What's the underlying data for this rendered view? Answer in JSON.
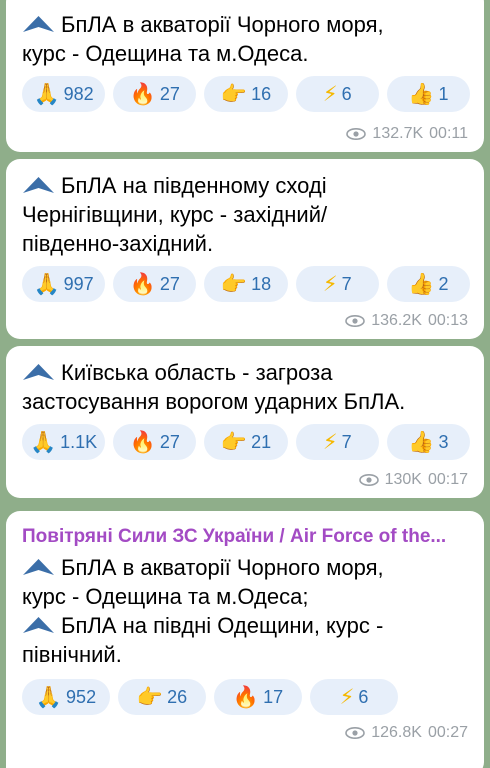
{
  "colors": {
    "background": "#8fae8a",
    "bubble": "#ffffff",
    "reaction_bg": "#e7effa",
    "reaction_text": "#2f6fb0",
    "sender": "#a34bc4",
    "meta": "#9aa0a6"
  },
  "messages": [
    {
      "lines": [
        "БпЛА в акваторії Чорного моря,",
        "курс - Одещина та м.Одеса."
      ],
      "drone_lines": [
        0
      ],
      "reactions": [
        {
          "icon": "praying-hands-icon",
          "count": "982"
        },
        {
          "icon": "fire-icon",
          "count": "27"
        },
        {
          "icon": "pointing-hand-icon",
          "count": "16"
        },
        {
          "icon": "lightning-icon",
          "count": "6"
        },
        {
          "icon": "thumbs-up-icon",
          "count": "1"
        }
      ],
      "views": "132.7K",
      "time": "00:11"
    },
    {
      "lines": [
        "БпЛА на південному сході",
        "Чернігівщини, курс - західний/",
        "південно-західний."
      ],
      "drone_lines": [
        0
      ],
      "reactions": [
        {
          "icon": "praying-hands-icon",
          "count": "997"
        },
        {
          "icon": "fire-icon",
          "count": "27"
        },
        {
          "icon": "pointing-hand-icon",
          "count": "18"
        },
        {
          "icon": "lightning-icon",
          "count": "7"
        },
        {
          "icon": "thumbs-up-icon",
          "count": "2"
        }
      ],
      "views": "136.2K",
      "time": "00:13"
    },
    {
      "lines": [
        "Київська область - загроза",
        "застосування ворогом ударних БпЛА."
      ],
      "drone_lines": [
        0
      ],
      "reactions": [
        {
          "icon": "praying-hands-icon",
          "count": "1.1K"
        },
        {
          "icon": "fire-icon",
          "count": "27"
        },
        {
          "icon": "pointing-hand-icon",
          "count": "21"
        },
        {
          "icon": "lightning-icon",
          "count": "7"
        },
        {
          "icon": "thumbs-up-icon",
          "count": "3"
        }
      ],
      "views": "130K",
      "time": "00:17"
    },
    {
      "sender": "Повітряні Сили ЗС України / Air Force of the...",
      "lines": [
        "БпЛА в акваторії Чорного моря,",
        "курс - Одещина та м.Одеса;",
        "БпЛА на півдні Одещини, курс -",
        "північний."
      ],
      "drone_lines": [
        0,
        2
      ],
      "reactions": [
        {
          "icon": "praying-hands-icon",
          "count": "952"
        },
        {
          "icon": "pointing-hand-icon",
          "count": "26"
        },
        {
          "icon": "fire-icon",
          "count": "17"
        },
        {
          "icon": "lightning-icon",
          "count": "6"
        }
      ],
      "views": "126.8K",
      "time": "00:27"
    }
  ]
}
